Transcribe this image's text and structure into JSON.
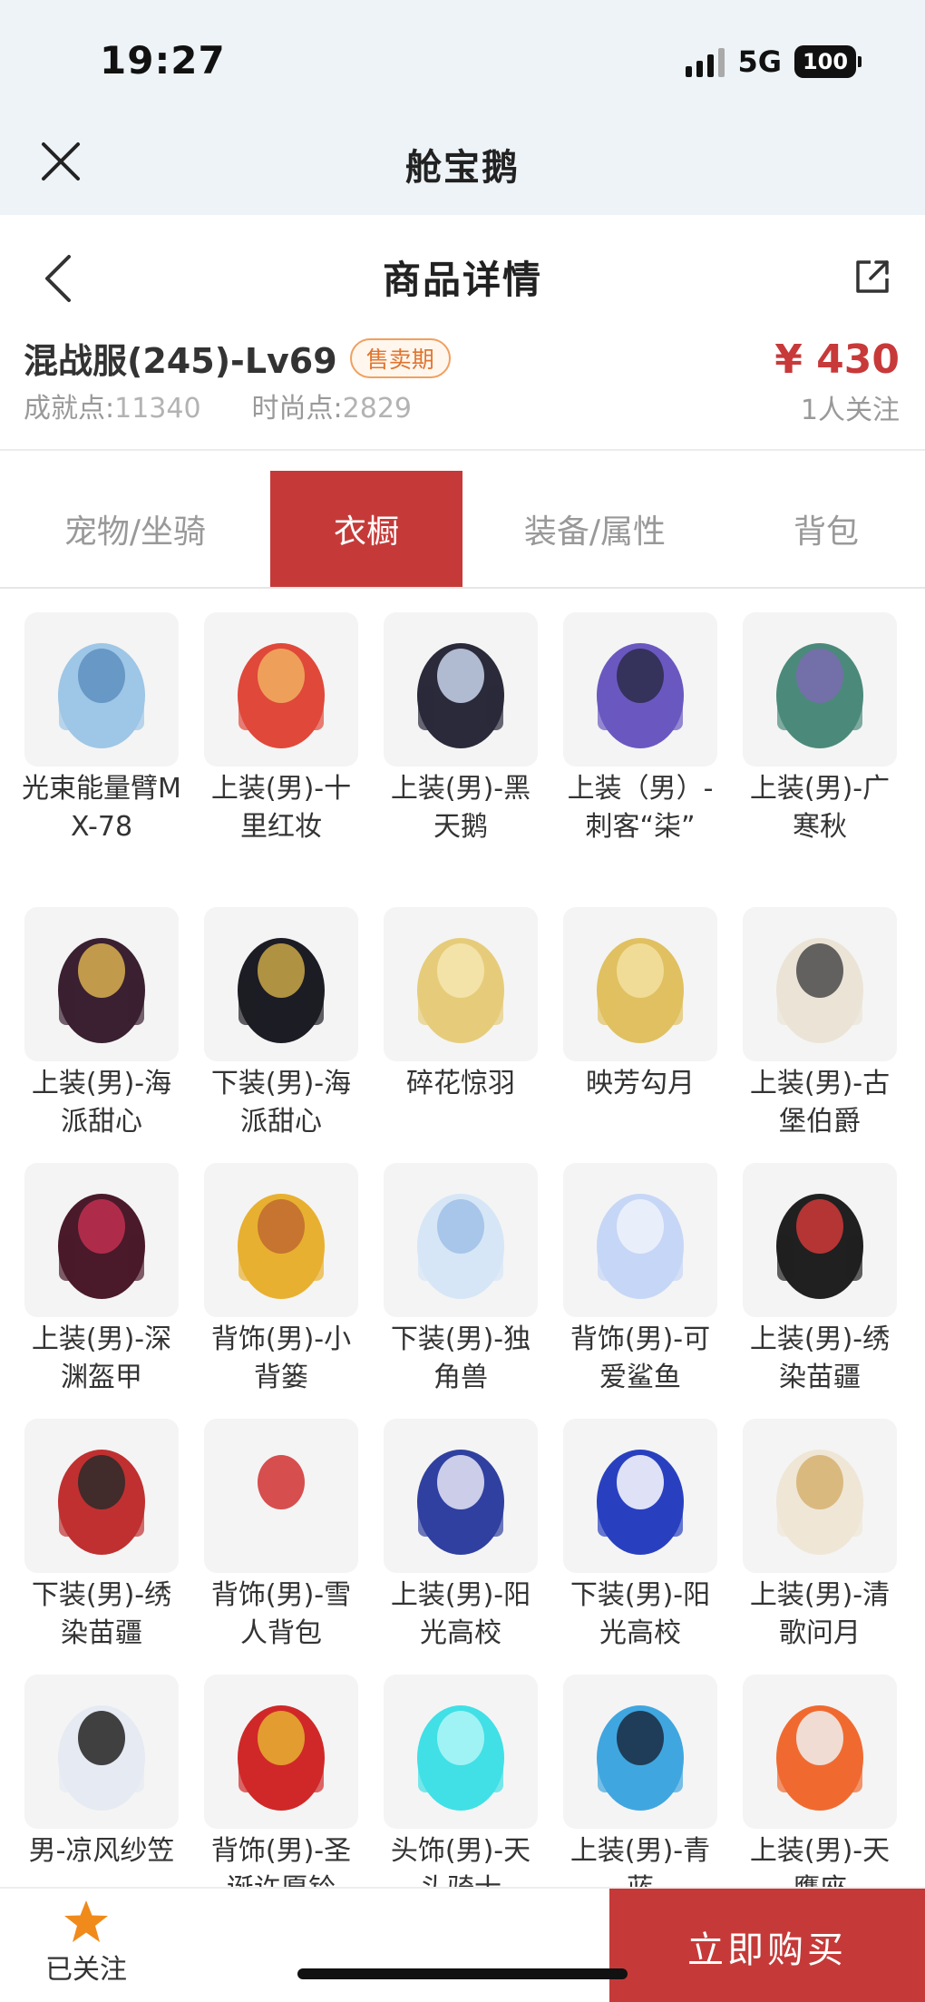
{
  "status_bar": {
    "time": "19:27",
    "network": "5G",
    "battery": "100"
  },
  "mini_program": {
    "title": "舱宝鹅"
  },
  "page": {
    "title": "商品详情"
  },
  "product": {
    "name": "混战服(245)-Lv69",
    "status": "售卖期",
    "achievement_label": "成就点:",
    "achievement_value": "11340",
    "fashion_label": "时尚点:",
    "fashion_value": "2829",
    "price": "¥ 430",
    "followers": "1人关注"
  },
  "tabs": [
    {
      "label": "宠物/坐骑",
      "active": false
    },
    {
      "label": "衣橱",
      "active": true
    },
    {
      "label": "装备/属性",
      "active": false
    },
    {
      "label": "背包",
      "active": false
    }
  ],
  "items": [
    {
      "label": "光束能量臂MX-78",
      "icon": "robotic-arm-icon",
      "colors": [
        "#9ec6e6",
        "#5d8fc0"
      ]
    },
    {
      "label": "上装(男)-十里红妆",
      "icon": "red-robe-icon",
      "colors": [
        "#e0483a",
        "#f0b060"
      ]
    },
    {
      "label": "上装(男)-黑天鹅",
      "icon": "black-suit-icon",
      "colors": [
        "#2a2a3a",
        "#c8d4ec"
      ]
    },
    {
      "label": "上装（男）-刺客“柒”",
      "icon": "purple-robe-icon",
      "colors": [
        "#6a58c0",
        "#2c2c4a"
      ]
    },
    {
      "label": "上装(男)-广寒秋",
      "icon": "teal-robe-icon",
      "colors": [
        "#4b8a7a",
        "#7a6ab0"
      ]
    },
    {
      "label": "上装(男)-海派甜心",
      "icon": "gold-jacket-icon",
      "colors": [
        "#3a2030",
        "#d9b050"
      ]
    },
    {
      "label": "下装(男)-海派甜心",
      "icon": "black-pants-icon",
      "colors": [
        "#1c1c24",
        "#c9a748"
      ]
    },
    {
      "label": "碎花惊羽",
      "icon": "gold-wings-icon",
      "colors": [
        "#e6cc7a",
        "#f4e6b0"
      ]
    },
    {
      "label": "映芳勾月",
      "icon": "gold-staff-icon",
      "colors": [
        "#e0c060",
        "#f2e0a0"
      ]
    },
    {
      "label": "上装(男)-古堡伯爵",
      "icon": "white-coat-icon",
      "colors": [
        "#ebe4d6",
        "#4a4a4a"
      ]
    },
    {
      "label": "上装(男)-深渊盔甲",
      "icon": "armor-icon",
      "colors": [
        "#4a1a2a",
        "#c03050"
      ]
    },
    {
      "label": "背饰(男)-小背篓",
      "icon": "flower-basket-icon",
      "colors": [
        "#e8b030",
        "#c06a30"
      ]
    },
    {
      "label": "下装(男)-独角兽",
      "icon": "unicorn-boots-icon",
      "colors": [
        "#d6e6f6",
        "#9fc0e6"
      ]
    },
    {
      "label": "背饰(男)-可爱鲨鱼",
      "icon": "shark-icon",
      "colors": [
        "#c6d6f6",
        "#eef2fc"
      ]
    },
    {
      "label": "上装(男)-绣染苗疆",
      "icon": "miao-top-icon",
      "colors": [
        "#202020",
        "#d03838"
      ]
    },
    {
      "label": "下装(男)-绣染苗疆",
      "icon": "miao-skirt-icon",
      "colors": [
        "#c03030",
        "#2a2a2a"
      ]
    },
    {
      "label": "背饰(男)-雪人背包",
      "icon": "snowman-icon",
      "colors": [
        "#f4f4f4",
        "#d03030"
      ]
    },
    {
      "label": "上装(男)-阳光高校",
      "icon": "school-jacket-icon",
      "colors": [
        "#3040a0",
        "#e6e6f6"
      ]
    },
    {
      "label": "下装(男)-阳光高校",
      "icon": "blue-shoes-icon",
      "colors": [
        "#2840c0",
        "#ffffff"
      ]
    },
    {
      "label": "上装(男)-清歌问月",
      "icon": "moon-robe-icon",
      "colors": [
        "#efe6d6",
        "#d6b070"
      ]
    },
    {
      "label": "男-凉风纱笠",
      "icon": "veil-hat-icon",
      "colors": [
        "#e6eaf2",
        "#222222"
      ]
    },
    {
      "label": "背饰(男)-圣诞许愿铃",
      "icon": "christmas-bell-icon",
      "colors": [
        "#d02828",
        "#e6b030"
      ]
    },
    {
      "label": "头饰(男)-天头骑士",
      "icon": "cyan-flame-icon",
      "colors": [
        "#40e0e6",
        "#b0f6f6"
      ]
    },
    {
      "label": "上装(男)-青蓝",
      "icon": "blue-robe-icon",
      "colors": [
        "#40a6e0",
        "#1a2a40"
      ]
    },
    {
      "label": "上装(男)-天鹰座",
      "icon": "orange-coat-icon",
      "colors": [
        "#f06a30",
        "#f0f0f0"
      ]
    }
  ],
  "bottom_bar": {
    "follow_label": "已关注",
    "buy_label": "立即购买",
    "star_color": "#f08a1a"
  }
}
